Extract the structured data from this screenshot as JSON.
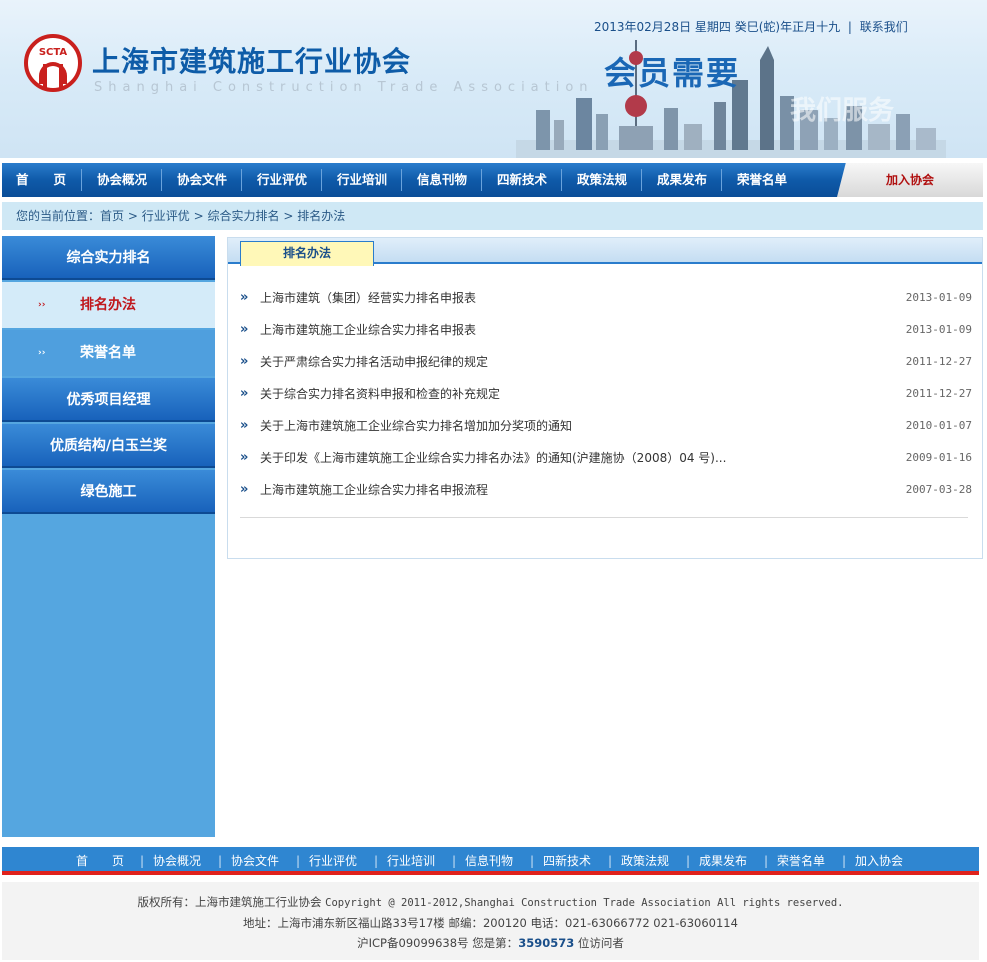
{
  "header": {
    "logo_text": "SCTA",
    "title_cn": "上海市建筑施工行业协会",
    "title_en": "Shanghai Construction Trade Association",
    "date_text": "2013年02月28日 星期四 癸巳(蛇)年正月十九",
    "contact_label": "联系我们",
    "slogan": "会员需要",
    "slogan_faded": "我们服务"
  },
  "nav": {
    "items": [
      "首　　页",
      "协会概况",
      "协会文件",
      "行业评优",
      "行业培训",
      "信息刊物",
      "四新技术",
      "政策法规",
      "成果发布",
      "荣誉名单"
    ],
    "join_label": "加入协会"
  },
  "breadcrumb": {
    "prefix": "您的当前位置：",
    "items": [
      "首页",
      "行业评优",
      "综合实力排名",
      "排名办法"
    ],
    "separator": ">"
  },
  "sidebar": {
    "section_top": "综合实力排名",
    "sub_active": "排名办法",
    "sub_normal": "荣誉名单",
    "sub_arrow": "››",
    "sections": [
      "优秀项目经理",
      "优质结构/白玉兰奖",
      "绿色施工"
    ]
  },
  "panel": {
    "tab_label": "排名办法",
    "bullet": "»",
    "rows": [
      {
        "title": "上海市建筑（集团）经营实力排名申报表",
        "date": "2013-01-09"
      },
      {
        "title": "上海市建筑施工企业综合实力排名申报表",
        "date": "2013-01-09"
      },
      {
        "title": "关于严肃综合实力排名活动申报纪律的规定",
        "date": "2011-12-27"
      },
      {
        "title": "关于综合实力排名资料申报和检查的补充规定",
        "date": "2011-12-27"
      },
      {
        "title": "关于上海市建筑施工企业综合实力排名增加加分奖项的通知",
        "date": "2010-01-07"
      },
      {
        "title": "关于印发《上海市建筑施工企业综合实力排名办法》的通知(沪建施协（2008）04 号)...",
        "date": "2009-01-16"
      },
      {
        "title": "上海市建筑施工企业综合实力排名申报流程",
        "date": "2007-03-28"
      }
    ]
  },
  "footer": {
    "nav_items": [
      "首　　页",
      "协会概况",
      "协会文件",
      "行业评优",
      "行业培训",
      "信息刊物",
      "四新技术",
      "政策法规",
      "成果发布",
      "荣誉名单",
      "加入协会"
    ],
    "nav_sep": "|",
    "copyright_cn": "版权所有：上海市建筑施工行业协会",
    "copyright_en": "Copyright @ 2011-2012,Shanghai Construction Trade Association All rights reserved.",
    "address": "地址：上海市浦东新区福山路33号17楼 邮编：200120 电话：021-63066772 021-63060114",
    "icp": "沪ICP备09099638号",
    "visitor_prefix": "您是第：",
    "visitor_count": "3590573",
    "visitor_suffix": "位访问者"
  },
  "colors": {
    "nav_blue": "#0f5aa9",
    "title_blue": "#0e5ca8",
    "logo_red": "#c9201d",
    "active_red": "#c0171c",
    "sidebar_blue": "#55a6e0",
    "footer_red_line": "#e0221c"
  }
}
